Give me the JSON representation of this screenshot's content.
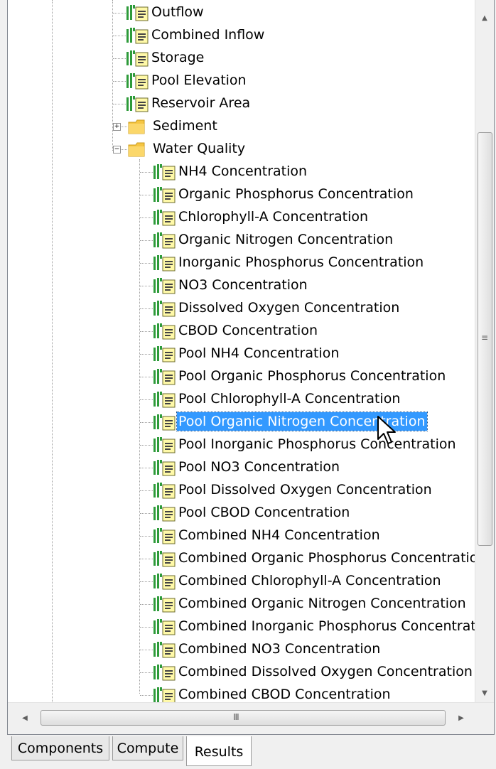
{
  "tree": {
    "top_items": [
      {
        "label": "Outflow",
        "type": "doc"
      },
      {
        "label": "Combined Inflow",
        "type": "doc"
      },
      {
        "label": "Storage",
        "type": "doc"
      },
      {
        "label": "Pool Elevation",
        "type": "doc"
      },
      {
        "label": "Reservoir Area",
        "type": "doc"
      }
    ],
    "folders": [
      {
        "label": "Sediment",
        "expander": "+",
        "expanded": false
      },
      {
        "label": "Water Quality",
        "expander": "−",
        "expanded": true
      }
    ],
    "water_quality_items": [
      "NH4 Concentration",
      "Organic Phosphorus Concentration",
      "Chlorophyll-A Concentration",
      "Organic Nitrogen Concentration",
      "Inorganic Phosphorus Concentration",
      "NO3 Concentration",
      "Dissolved Oxygen Concentration",
      "CBOD Concentration",
      "Pool NH4 Concentration",
      "Pool Organic Phosphorus Concentration",
      "Pool Chlorophyll-A Concentration",
      "Pool Organic Nitrogen Concentration",
      "Pool Inorganic Phosphorus Concentration",
      "Pool NO3 Concentration",
      "Pool Dissolved Oxygen Concentration",
      "Pool CBOD Concentration",
      "Combined NH4 Concentration",
      "Combined Organic Phosphorus Concentratio",
      "Combined Chlorophyll-A Concentration",
      "Combined Organic Nitrogen Concentration",
      "Combined Inorganic Phosphorus Concentrat",
      "Combined NO3 Concentration",
      "Combined Dissolved Oxygen Concentration",
      "Combined CBOD Concentration"
    ],
    "selected_item": "Pool Organic Nitrogen Concentration"
  },
  "scrollbars": {
    "vertical": {
      "up_glyph": "▲",
      "down_glyph": "▼",
      "grip": "≡"
    },
    "horizontal": {
      "left_glyph": "◀",
      "right_glyph": "▶",
      "grip": "III"
    }
  },
  "tabs": [
    {
      "label": "Components",
      "active": false
    },
    {
      "label": "Compute",
      "active": false
    },
    {
      "label": "Results",
      "active": true
    }
  ],
  "colors": {
    "selection": "#3399ff",
    "icon_green": "#2e9b3a",
    "icon_doc": "#fff9a8",
    "folder": "#f5c542"
  }
}
